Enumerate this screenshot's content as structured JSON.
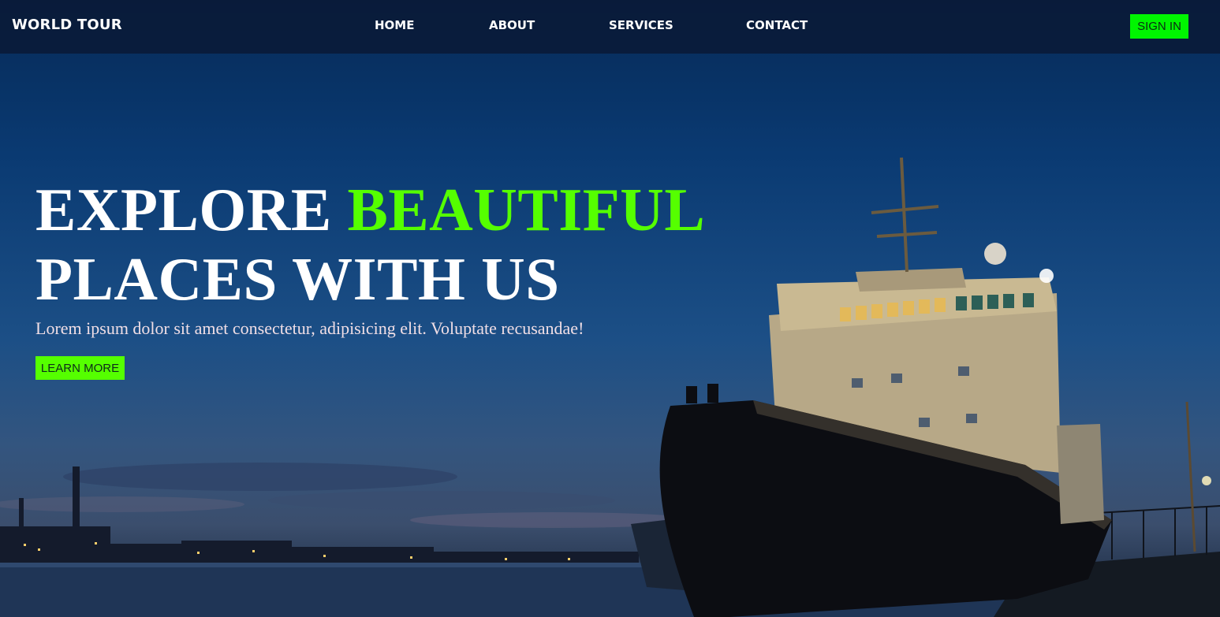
{
  "brand": {
    "name": "WORLD TOUR"
  },
  "nav": {
    "items": [
      {
        "label": "HOME"
      },
      {
        "label": "ABOUT"
      },
      {
        "label": "SERVICES"
      },
      {
        "label": "CONTACT"
      }
    ],
    "signin_label": "SIGN IN"
  },
  "hero": {
    "headline_part1": "EXPLORE",
    "headline_accent": "BEAUTIFUL",
    "headline_part2": "PLACES WITH US",
    "subtext": "Lorem ipsum dolor sit amet consectetur, adipisicing elit. Voluptate recusandae!",
    "cta_label": "LEARN MORE"
  },
  "colors": {
    "accent": "#55ff00",
    "signin_button": "#00f500",
    "navbar": "#0a1834",
    "text": "#ffffff"
  },
  "background": {
    "subject": "ship-at-harbor-night-photo"
  }
}
